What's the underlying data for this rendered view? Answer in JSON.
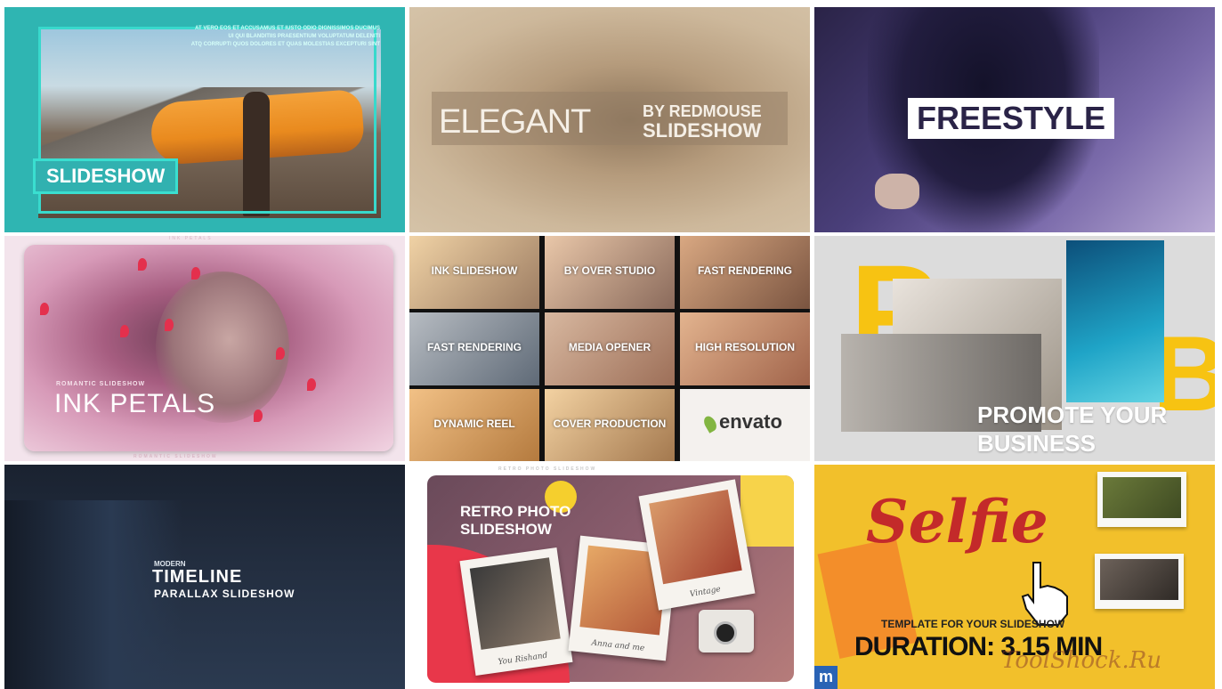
{
  "tiles": {
    "t1": {
      "label": "SLIDESHOW",
      "small_text": [
        "AT VERO EOS ET ACCUSAMUS ET IUSTO ODIO DIGNISSIMOS DUCIMUS",
        "UI QUI BLANDITIIS PRAESENTIUM VOLUPTATUM DELENITI",
        "ATQ CORRUPTI QUOS DOLORES ET QUAS MOLESTIAS EXCEPTURI SINT"
      ]
    },
    "t2": {
      "title": "ELEGANT",
      "by": "BY REDMOUSE",
      "sub": "SLIDESHOW"
    },
    "t3": {
      "label": "FREESTYLE"
    },
    "t4": {
      "top_caption": "INK PETALS",
      "subtitle": "ROMANTIC SLIDESHOW",
      "title": "INK PETALS",
      "footer": "ROMANTIC SLIDESHOW"
    },
    "t5": {
      "cells": [
        "INK SLIDESHOW",
        "BY OVER STUDIO",
        "FAST RENDERING",
        "FAST RENDERING",
        "MEDIA OPENER",
        "HIGH RESOLUTION",
        "DYNAMIC REEL",
        "COVER PRODUCTION",
        "envato"
      ]
    },
    "t6": {
      "line1": "PROMOTE YOUR",
      "line2": "BUSINESS",
      "letters": [
        "P",
        "B"
      ]
    },
    "t7": {
      "line1": "MODERN",
      "line2": "TIMELINE",
      "line3": "PARALLAX SLIDESHOW"
    },
    "t8": {
      "title_line1": "RETRO PHOTO",
      "title_line2": "SLIDESHOW",
      "footer": "RETRO PHOTO SLIDESHOW",
      "captions": [
        "You Rishand",
        "Anna and me",
        "Vintage"
      ]
    },
    "t9": {
      "title": "Selfie",
      "template": "TEMPLATE FOR YOUR SLIDESHOW",
      "duration": "DURATION: 3.15 MIN",
      "logo": "m",
      "watermark": "ToolShock.Ru"
    }
  },
  "colors": {
    "teal": "#2fb5b2",
    "yellow": "#f7c312",
    "red": "#c32a2a"
  }
}
